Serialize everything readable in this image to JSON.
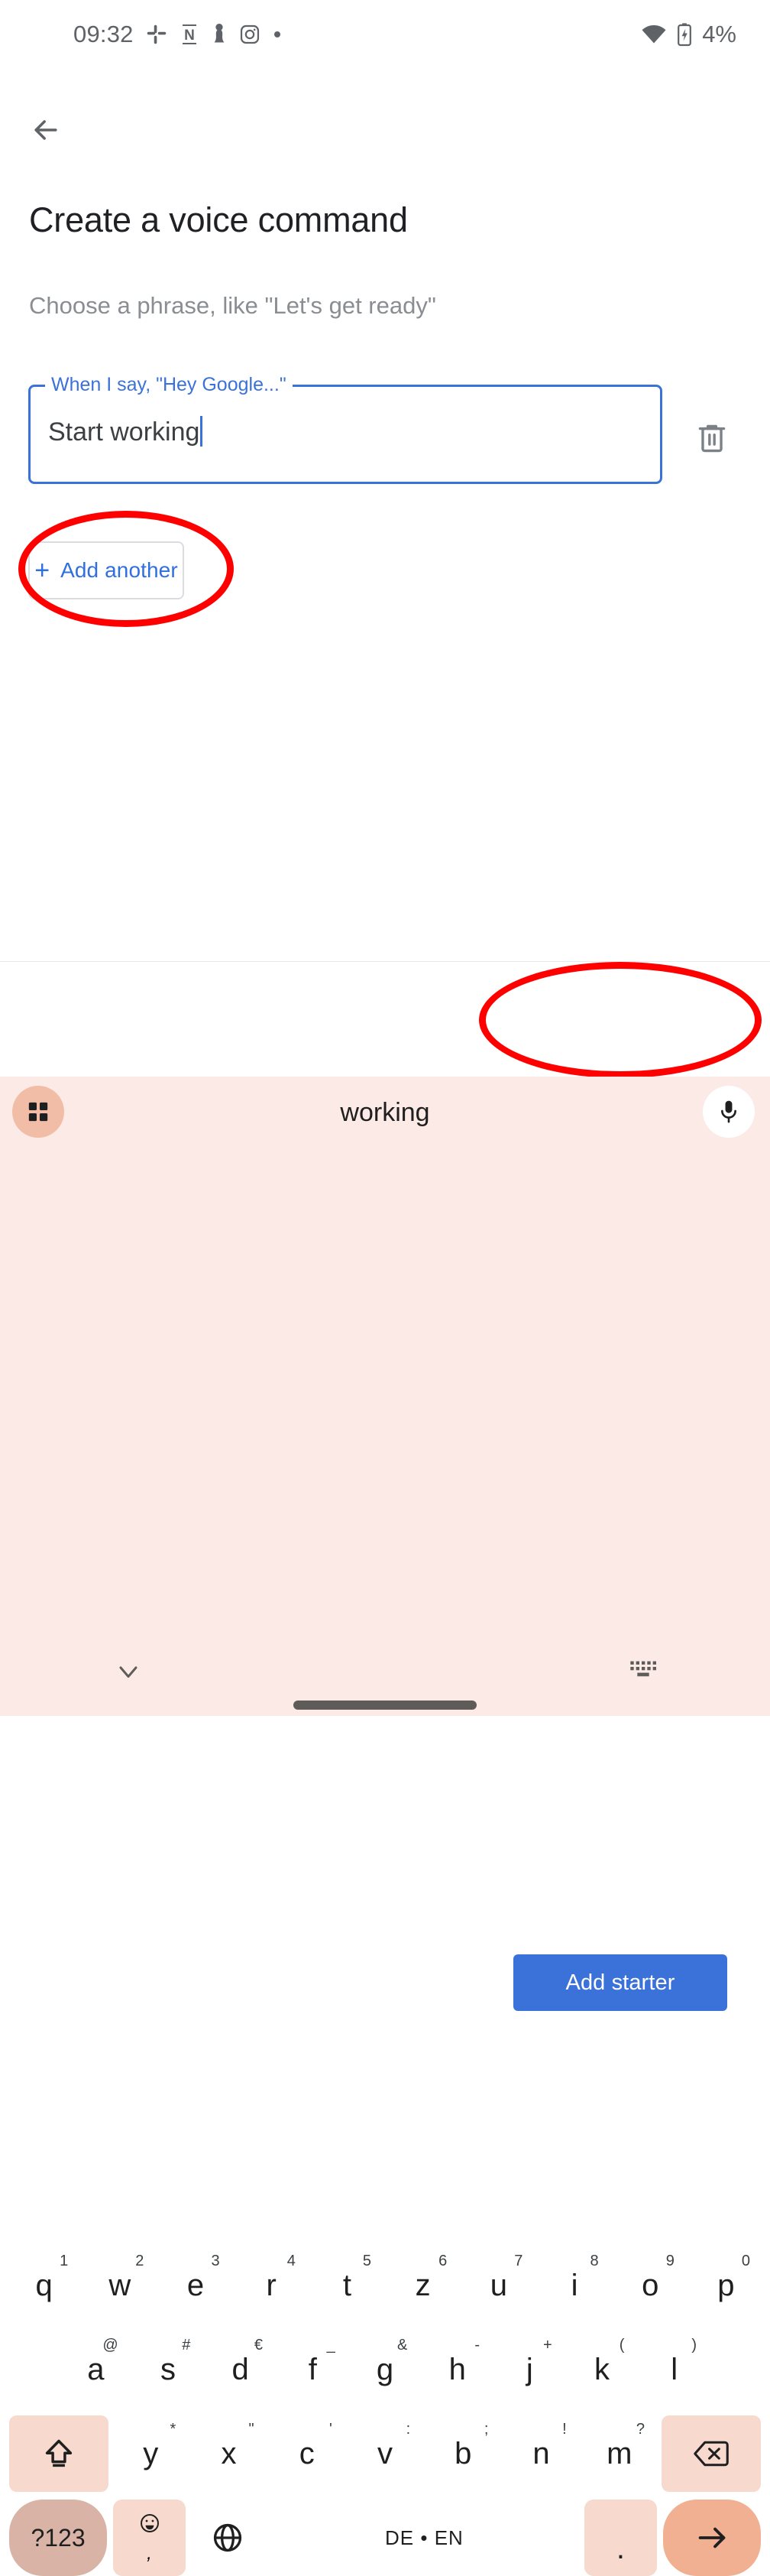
{
  "statusbar": {
    "time": "09:32",
    "battery_percent": "4%",
    "icons": [
      "slack-icon",
      "n-notification-icon",
      "chess-pawn-icon",
      "instagram-icon",
      "dot-icon"
    ],
    "right_icons": [
      "wifi-icon",
      "battery-charging-icon"
    ]
  },
  "appbar": {
    "back_label": "back-arrow"
  },
  "content": {
    "title": "Create a voice command",
    "subtitle": "Choose a phrase, like \"Let's get ready\"",
    "field": {
      "label": "When I say, \"Hey Google...\"",
      "value": "Start working",
      "placeholder": "When I say, \"Hey Google...\""
    },
    "delete_icon": "trash-icon",
    "add_another": {
      "plus": "+",
      "label": "Add another"
    }
  },
  "action_bar": {
    "primary_label": "Add starter"
  },
  "annotations": {
    "color": "#ff0000",
    "targets": [
      "add-another",
      "add-starter"
    ]
  },
  "keyboard": {
    "suggestion": "working",
    "grid_icon": "grid-icon",
    "mic_icon": "microphone-icon",
    "rows": [
      [
        {
          "main": "q",
          "sub": "1"
        },
        {
          "main": "w",
          "sub": "2"
        },
        {
          "main": "e",
          "sub": "3"
        },
        {
          "main": "r",
          "sub": "4"
        },
        {
          "main": "t",
          "sub": "5"
        },
        {
          "main": "z",
          "sub": "6"
        },
        {
          "main": "u",
          "sub": "7"
        },
        {
          "main": "i",
          "sub": "8"
        },
        {
          "main": "o",
          "sub": "9"
        },
        {
          "main": "p",
          "sub": "0"
        }
      ],
      [
        {
          "main": "a",
          "sub": "@"
        },
        {
          "main": "s",
          "sub": "#"
        },
        {
          "main": "d",
          "sub": "€"
        },
        {
          "main": "f",
          "sub": "_"
        },
        {
          "main": "g",
          "sub": "&"
        },
        {
          "main": "h",
          "sub": "-"
        },
        {
          "main": "j",
          "sub": "+"
        },
        {
          "main": "k",
          "sub": "("
        },
        {
          "main": "l",
          "sub": ")"
        }
      ],
      [
        {
          "main": "y",
          "sub": "*"
        },
        {
          "main": "x",
          "sub": "\""
        },
        {
          "main": "c",
          "sub": "'"
        },
        {
          "main": "v",
          "sub": ":"
        },
        {
          "main": "b",
          "sub": ";"
        },
        {
          "main": "n",
          "sub": "!"
        },
        {
          "main": "m",
          "sub": "?"
        }
      ]
    ],
    "shift_icon": "shift-icon",
    "backspace_icon": "backspace-icon",
    "bottom_row": {
      "numbers_label": "?123",
      "emoji_icon": "emoji-icon",
      "comma_label": ",",
      "globe_icon": "globe-icon",
      "space_label": "DE • EN",
      "period_label": ".",
      "enter_icon": "enter-arrow-icon"
    }
  },
  "sysnav": {
    "down_icon": "chevron-down-icon",
    "home_bar": "home-gesture-bar",
    "keyboard_switch_icon": "keyboard-switch-icon"
  }
}
